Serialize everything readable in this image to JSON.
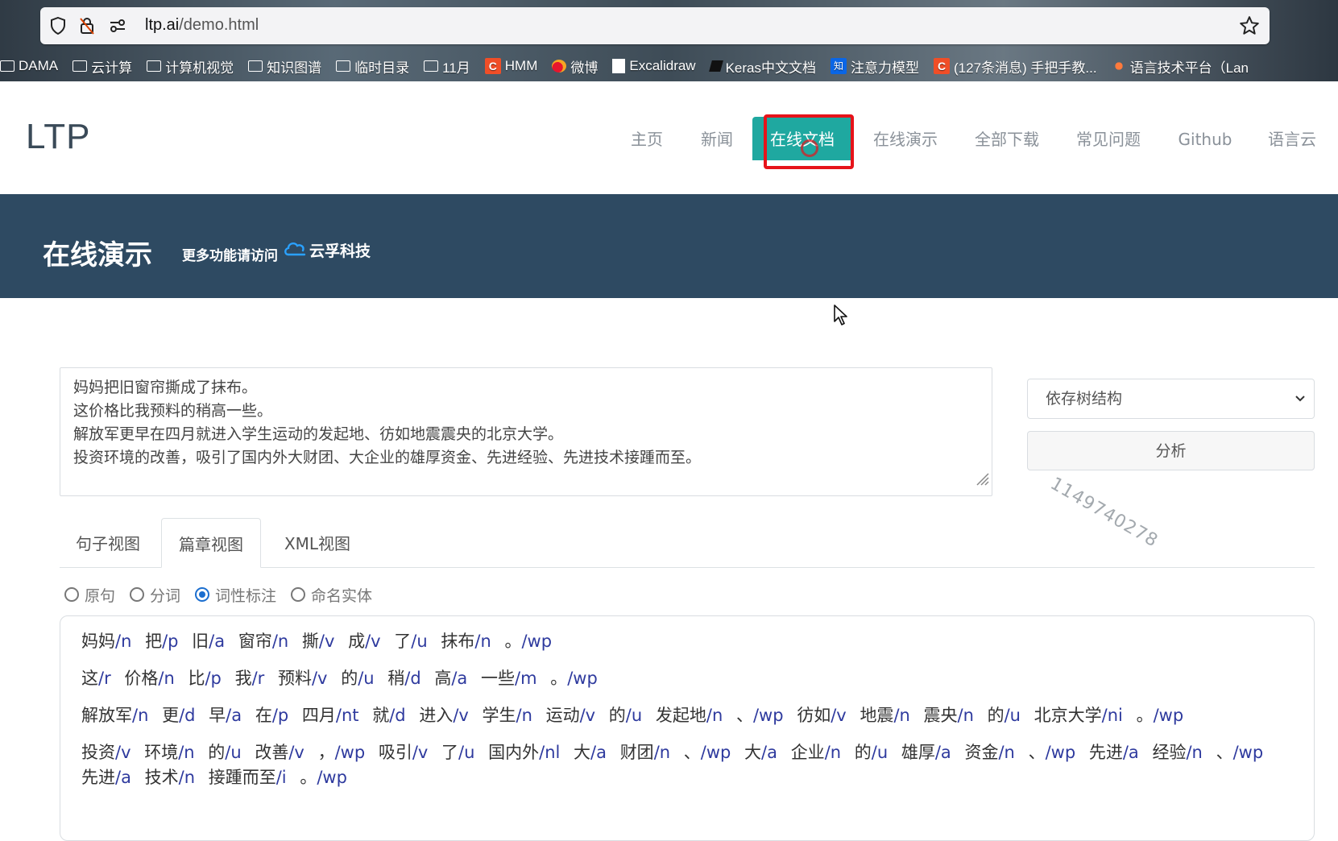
{
  "browser": {
    "url_host": "ltp.ai",
    "url_path": "/demo.html",
    "bookmarks": [
      {
        "label": "DAMA",
        "icon": "folder-icon"
      },
      {
        "label": "云计算",
        "icon": "folder-icon"
      },
      {
        "label": "计算机视觉",
        "icon": "folder-icon"
      },
      {
        "label": "知识图谱",
        "icon": "folder-icon"
      },
      {
        "label": "临时目录",
        "icon": "folder-icon"
      },
      {
        "label": "11月",
        "icon": "folder-icon"
      },
      {
        "label": "HMM",
        "icon": "csdn-icon"
      },
      {
        "label": "微博",
        "icon": "weibo-icon"
      },
      {
        "label": "Excalidraw",
        "icon": "excalidraw-icon"
      },
      {
        "label": "Keras中文文档",
        "icon": "book-icon"
      },
      {
        "label": "注意力模型",
        "icon": "zhihu-icon"
      },
      {
        "label": "(127条消息) 手把手教...",
        "icon": "csdn-icon"
      },
      {
        "label": "语言技术平台（Lan",
        "icon": "ltp-icon"
      }
    ]
  },
  "site": {
    "logo": "LTP",
    "nav": [
      "主页",
      "新闻",
      "在线文档",
      "在线演示",
      "全部下载",
      "常见问题",
      "Github",
      "语言云"
    ],
    "active_nav": "在线文档"
  },
  "banner": {
    "title": "在线演示",
    "subtitle": "更多功能请访问",
    "partner": "云孚科技"
  },
  "input": {
    "lines": [
      "妈妈把旧窗帘撕成了抹布。",
      "这价格比我预料的稍高一些。",
      "解放军更早在四月就进入学生运动的发起地、彷如地震震央的北京大学。",
      "投资环境的改善，吸引了国内外大财团、大企业的雄厚资金、先进经验、先进技术接踵而至。"
    ]
  },
  "controls": {
    "select_value": "依存树结构",
    "analyze_label": "分析",
    "watermark": "1149740278"
  },
  "tabs": [
    "句子视图",
    "篇章视图",
    "XML视图"
  ],
  "active_tab": "篇章视图",
  "radios": [
    {
      "label": "原句",
      "checked": false
    },
    {
      "label": "分词",
      "checked": false
    },
    {
      "label": "词性标注",
      "checked": true
    },
    {
      "label": "命名实体",
      "checked": false
    }
  ],
  "result": [
    [
      [
        "妈妈",
        "/n"
      ],
      [
        "把",
        "/p"
      ],
      [
        "旧",
        "/a"
      ],
      [
        "窗帘",
        "/n"
      ],
      [
        "撕",
        "/v"
      ],
      [
        "成",
        "/v"
      ],
      [
        "了",
        "/u"
      ],
      [
        "抹布",
        "/n"
      ],
      [
        "。",
        "/wp"
      ]
    ],
    [
      [
        "这",
        "/r"
      ],
      [
        "价格",
        "/n"
      ],
      [
        "比",
        "/p"
      ],
      [
        "我",
        "/r"
      ],
      [
        "预料",
        "/v"
      ],
      [
        "的",
        "/u"
      ],
      [
        "稍",
        "/d"
      ],
      [
        "高",
        "/a"
      ],
      [
        "一些",
        "/m"
      ],
      [
        "。",
        "/wp"
      ]
    ],
    [
      [
        "解放军",
        "/n"
      ],
      [
        "更",
        "/d"
      ],
      [
        "早",
        "/a"
      ],
      [
        "在",
        "/p"
      ],
      [
        "四月",
        "/nt"
      ],
      [
        "就",
        "/d"
      ],
      [
        "进入",
        "/v"
      ],
      [
        "学生",
        "/n"
      ],
      [
        "运动",
        "/v"
      ],
      [
        "的",
        "/u"
      ],
      [
        "发起地",
        "/n"
      ],
      [
        "、",
        "/wp"
      ],
      [
        "彷如",
        "/v"
      ],
      [
        "地震",
        "/n"
      ],
      [
        "震央",
        "/n"
      ],
      [
        "的",
        "/u"
      ],
      [
        "北京大学",
        "/ni"
      ],
      [
        "。",
        "/wp"
      ]
    ],
    [
      [
        "投资",
        "/v"
      ],
      [
        "环境",
        "/n"
      ],
      [
        "的",
        "/u"
      ],
      [
        "改善",
        "/v"
      ],
      [
        "，",
        "/wp"
      ],
      [
        "吸引",
        "/v"
      ],
      [
        "了",
        "/u"
      ],
      [
        "国内外",
        "/nl"
      ],
      [
        "大",
        "/a"
      ],
      [
        "财团",
        "/n"
      ],
      [
        "、",
        "/wp"
      ],
      [
        "大",
        "/a"
      ],
      [
        "企业",
        "/n"
      ],
      [
        "的",
        "/u"
      ],
      [
        "雄厚",
        "/a"
      ],
      [
        "资金",
        "/n"
      ],
      [
        "、",
        "/wp"
      ],
      [
        "先进",
        "/a"
      ],
      [
        "经验",
        "/n"
      ],
      [
        "、",
        "/wp"
      ],
      [
        "先进",
        "/a"
      ],
      [
        "技术",
        "/n"
      ],
      [
        "接踵而至",
        "/i"
      ],
      [
        "。",
        "/wp"
      ]
    ]
  ]
}
